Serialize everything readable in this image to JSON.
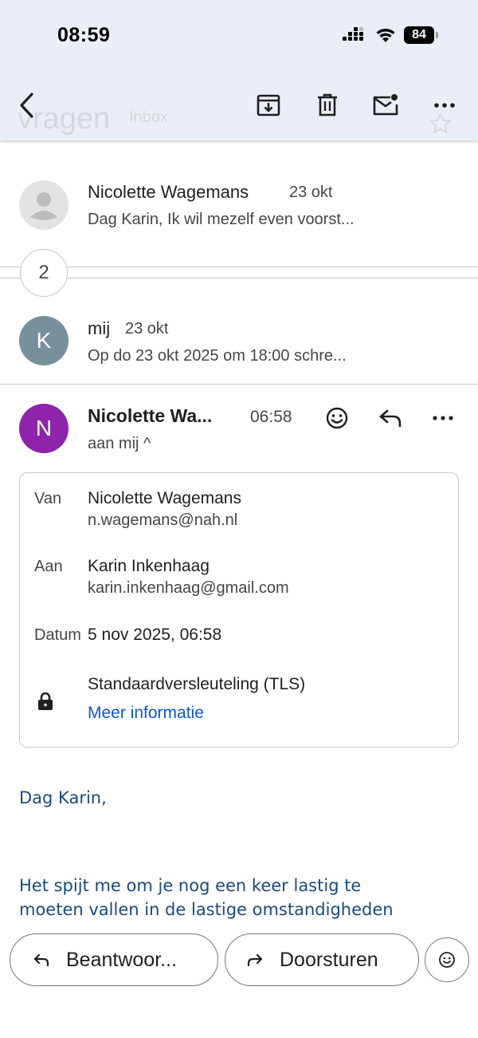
{
  "status_bar": {
    "time": "08:59",
    "battery": "84"
  },
  "toolbar": {
    "ghost_subject": "vragen",
    "ghost_label": "Inbox"
  },
  "thread": {
    "collapsed": [
      {
        "sender": "Nicolette Wagemans",
        "date": "23 okt",
        "snippet": "Dag Karin, Ik wil mezelf even voorst...",
        "avatar_type": "placeholder"
      },
      {
        "sender": "mij",
        "date": "23 okt",
        "snippet": "Op do 23 okt 2025 om 18:00 schre...",
        "avatar_letter": "K",
        "avatar_color": "#78909c"
      }
    ],
    "hidden_count": "2",
    "expanded": {
      "avatar_letter": "N",
      "avatar_color": "#8e24aa",
      "sender": "Nicolette Wa...",
      "time": "06:58",
      "to_line": "aan mij ^",
      "details": {
        "from_label": "Van",
        "from_name": "Nicolette Wagemans",
        "from_email": "n.wagemans@nah.nl",
        "to_label": "Aan",
        "to_name": "Karin Inkenhaag",
        "to_email": "karin.inkenhaag@gmail.com",
        "date_label": "Datum",
        "date_value": "5 nov 2025, 06:58",
        "security": "Standaardversleuteling (TLS)",
        "more_info": "Meer informatie"
      },
      "body": {
        "greeting": "Dag Karin,",
        "line1": "Het spijt me om je nog een keer lastig te",
        "line2": "moeten vallen in de lastige omstandigheden"
      }
    }
  },
  "actions": {
    "reply": "Beantwoor...",
    "forward": "Doorsturen"
  },
  "colors": {
    "accent_link": "#0b57d0",
    "body_text": "#1a4a7e",
    "top_bar": "#eaeef6"
  }
}
